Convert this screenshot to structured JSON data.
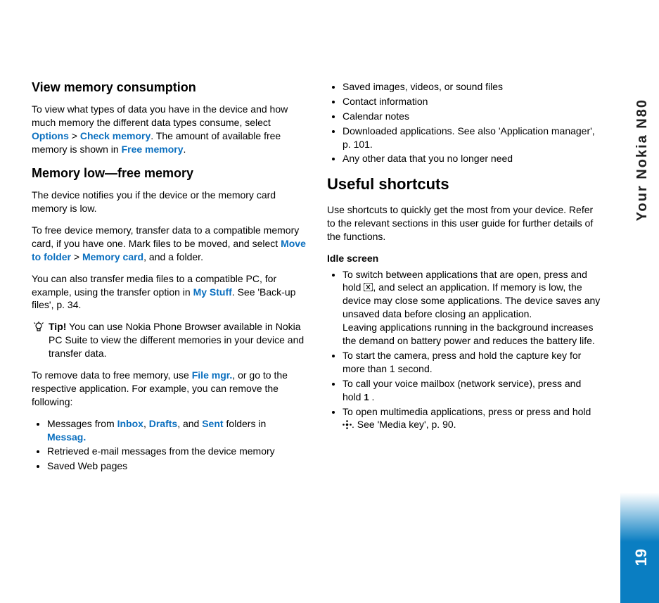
{
  "side_label": "Your Nokia N80",
  "page_number": "19",
  "left": {
    "h_view": "View memory consumption",
    "p_view_a": "To view what types of data you have in the device and how much memory the different data types consume, select ",
    "opt": "Options",
    "gt1": " > ",
    "check_mem": "Check memory",
    "p_view_b": ". The amount of available free memory is shown in ",
    "free_mem": "Free memory",
    "p_view_c": ".",
    "h_low": "Memory low—free memory",
    "p_low1": "The device notifies you if the device or the memory card memory is low.",
    "p_low2a": "To free device memory, transfer data to a compatible memory card, if you have one. Mark files to be moved, and select ",
    "move_folder": "Move to folder",
    "gt2": " > ",
    "mem_card": "Memory card",
    "p_low2b": ", and a folder.",
    "p_low3a": "You can also transfer media files to a compatible PC, for example, using the transfer option in ",
    "my_stuff": "My Stuff",
    "p_low3b": ". See 'Back-up files', p. 34.",
    "tip_label": "Tip!",
    "tip_body": " You can use Nokia Phone Browser available in Nokia PC Suite to view the different memories in your device and transfer data.",
    "p_remove_a": "To remove data to free memory, use ",
    "file_mgr": "File mgr.",
    "p_remove_b": ", or go to the respective application. For example, you can remove the following:",
    "li1a": "Messages from ",
    "inbox": "Inbox",
    "comma1": ", ",
    "drafts": "Drafts",
    "comma2": ", and ",
    "sent": "Sent",
    "li1b": " folders in ",
    "messag": "Messag.",
    "li2": "Retrieved e-mail messages from the device memory",
    "li3": "Saved Web pages"
  },
  "right": {
    "li4": "Saved images, videos, or sound files",
    "li5": "Contact information",
    "li6": "Calendar notes",
    "li7": "Downloaded applications. See also 'Application manager', p. 101.",
    "li8": "Any other data that you no longer need",
    "h_useful": "Useful shortcuts",
    "p_useful": "Use shortcuts to quickly get the most from your device. Refer to the relevant sections in this user guide for further details of the functions.",
    "idle": "Idle screen",
    "idle_li1a": "To switch between applications that are open, press and hold ",
    "idle_li1b": ", and select an application. If memory is low, the device may close some applications. The device saves any unsaved data before closing an application.",
    "idle_li1c": "Leaving applications running in the background increases the demand on battery power and reduces the battery life.",
    "idle_li2": "To start the camera, press and hold the capture key for more than 1 second.",
    "idle_li3a": "To call your voice mailbox (network service), press and hold ",
    "idle_li3b": " .",
    "idle_li4a": "To open multimedia applications, press or press and hold ",
    "idle_li4b": ". See 'Media key', p. 90."
  }
}
